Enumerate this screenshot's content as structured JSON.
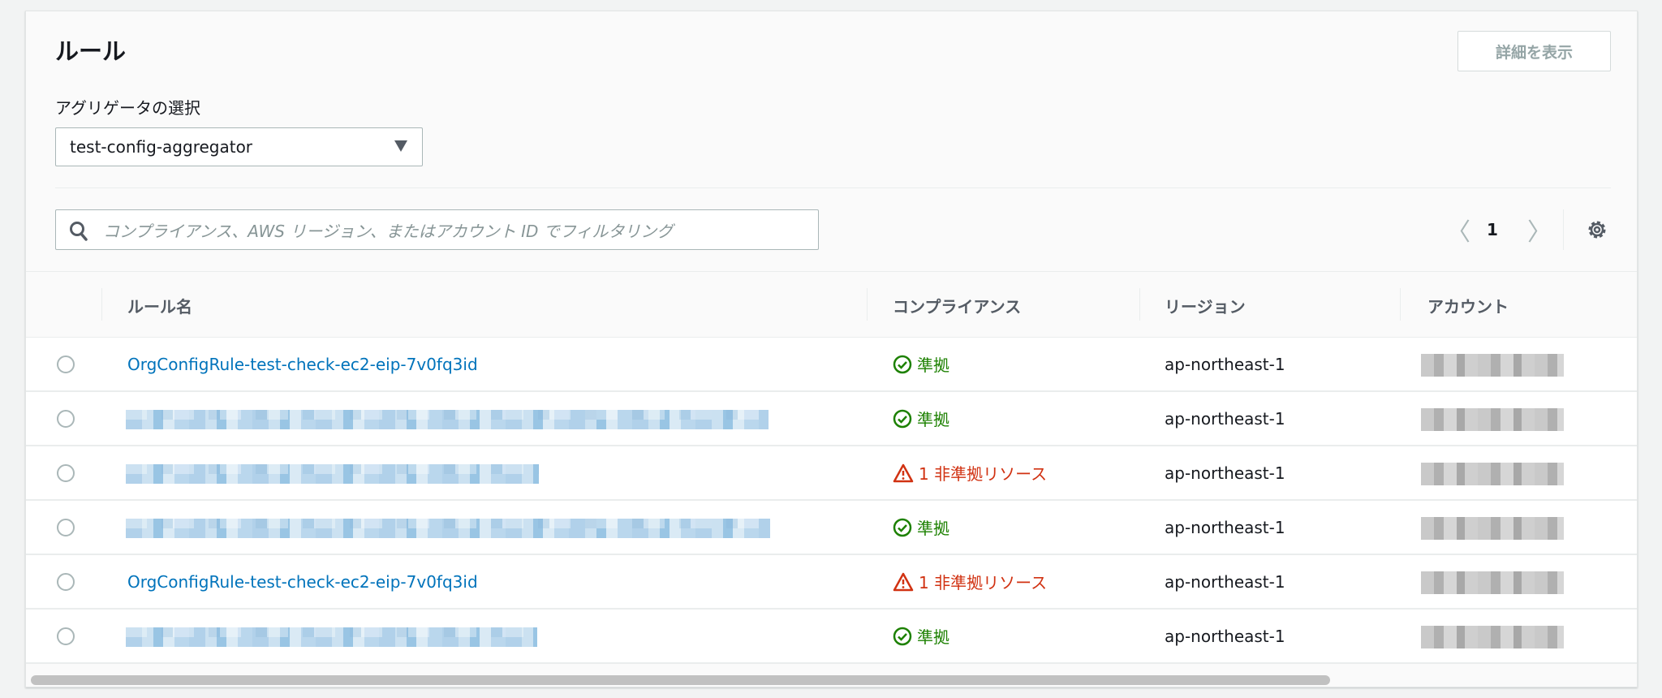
{
  "header": {
    "title": "ルール",
    "detail_button": "詳細を表示"
  },
  "aggregator": {
    "label": "アグリゲータの選択",
    "selected": "test-config-aggregator"
  },
  "search": {
    "placeholder": "コンプライアンス、AWS リージョン、またはアカウント ID でフィルタリング"
  },
  "pagination": {
    "prev": "〈",
    "page": "1",
    "next": "〉"
  },
  "columns": [
    "ルール名",
    "コンプライアンス",
    "リージョン",
    "アカウント"
  ],
  "rows": [
    {
      "name": "OrgConfigRule-test-check-ec2-eip-7v0fq3id",
      "compliance": "準拠",
      "status": "compliant",
      "region": "ap-northeast-1"
    },
    {
      "name": "",
      "compliance": "準拠",
      "status": "compliant",
      "region": "ap-northeast-1"
    },
    {
      "name": "",
      "compliance": "1 非準拠リソース",
      "status": "noncompliant",
      "region": "ap-northeast-1"
    },
    {
      "name": "",
      "compliance": "準拠",
      "status": "compliant",
      "region": "ap-northeast-1"
    },
    {
      "name": "OrgConfigRule-test-check-ec2-eip-7v0fq3id",
      "compliance": "1 非準拠リソース",
      "status": "noncompliant",
      "region": "ap-northeast-1"
    },
    {
      "name": "",
      "compliance": "準拠",
      "status": "compliant",
      "region": "ap-northeast-1"
    }
  ],
  "colors": {
    "link": "#0073bb",
    "compliant": "#1d8102",
    "noncompliant": "#d13212"
  }
}
